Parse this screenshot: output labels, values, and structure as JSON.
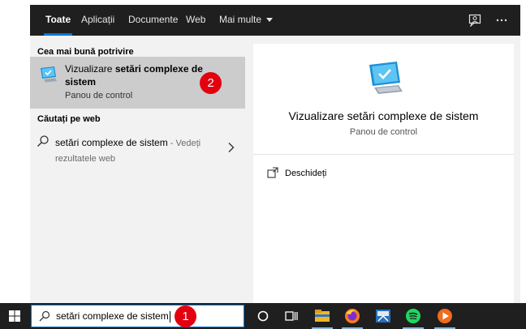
{
  "tabs": {
    "all": "Toate",
    "apps": "Aplicații",
    "documents": "Documente",
    "web": "Web",
    "more": "Mai multe"
  },
  "left_pane": {
    "best_match_heading": "Cea mai bună potrivire",
    "best_match": {
      "title_plain": "Vizualizare ",
      "title_bold_1": "setări complexe de",
      "title_bold_2": "sistem",
      "subtitle": "Panou de control",
      "icon": "monitor-check-icon"
    },
    "web_heading": "Căutați pe web",
    "web_result": {
      "query": "setări complexe de sistem",
      "suffix": " - Vedeți rezultatele web",
      "icon": "search-icon"
    }
  },
  "right_pane": {
    "title": "Vizualizare setări complexe de sistem",
    "subtitle": "Panou de control",
    "actions": [
      {
        "label": "Deschideți",
        "icon": "open-icon"
      }
    ]
  },
  "taskbar": {
    "search_value": "setări complexe de sistem",
    "icons": [
      "windows-icon",
      "cortana-icon",
      "task-view-icon",
      "file-explorer-icon",
      "firefox-icon",
      "snip-sketch-icon",
      "spotify-icon",
      "media-player-icon"
    ]
  },
  "badges": {
    "step_1": "1",
    "step_2": "2"
  },
  "colors": {
    "accent": "#0078d7",
    "dark_bar": "#1f1f1f",
    "selected_row": "#cccccc",
    "badge_red": "#e3000f"
  }
}
